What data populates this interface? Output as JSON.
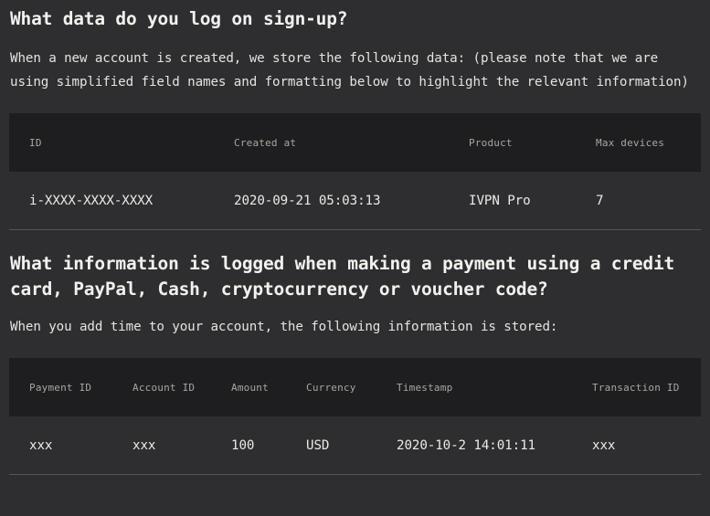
{
  "document": {
    "theme_colors": {
      "page_background": "#2e2e31",
      "table_header_background": "#1e1e21",
      "table_row_background": "#2e2e31",
      "heading_text": "#f3f1ee",
      "body_text": "#e6e3df",
      "table_header_text": "#a9a6a1",
      "table_cell_text": "#eceae6",
      "row_divider": "#55555a"
    },
    "sections": [
      {
        "heading": "What data do you log on sign-up?",
        "paragraph": "When a new account is created, we store the following data: (please note that we are using simplified field names and formatting below to highlight the relevant information)",
        "table": {
          "columns": [
            "ID",
            "Created at",
            "Product",
            "Max devices"
          ],
          "rows": [
            [
              "i-XXXX-XXXX-XXXX",
              "2020-09-21 05:03:13",
              "IVPN Pro",
              "7"
            ]
          ]
        }
      },
      {
        "heading": "What information is logged when making a payment using a credit card, PayPal, Cash, cryptocurrency or voucher code?",
        "paragraph": "When you add time to your account, the following information is stored:",
        "table": {
          "columns": [
            "Payment ID",
            "Account ID",
            "Amount",
            "Currency",
            "Timestamp",
            "Transaction ID"
          ],
          "rows": [
            [
              "xxx",
              "xxx",
              "100",
              "USD",
              "2020-10-2 14:01:11",
              "xxx"
            ]
          ]
        }
      }
    ]
  }
}
